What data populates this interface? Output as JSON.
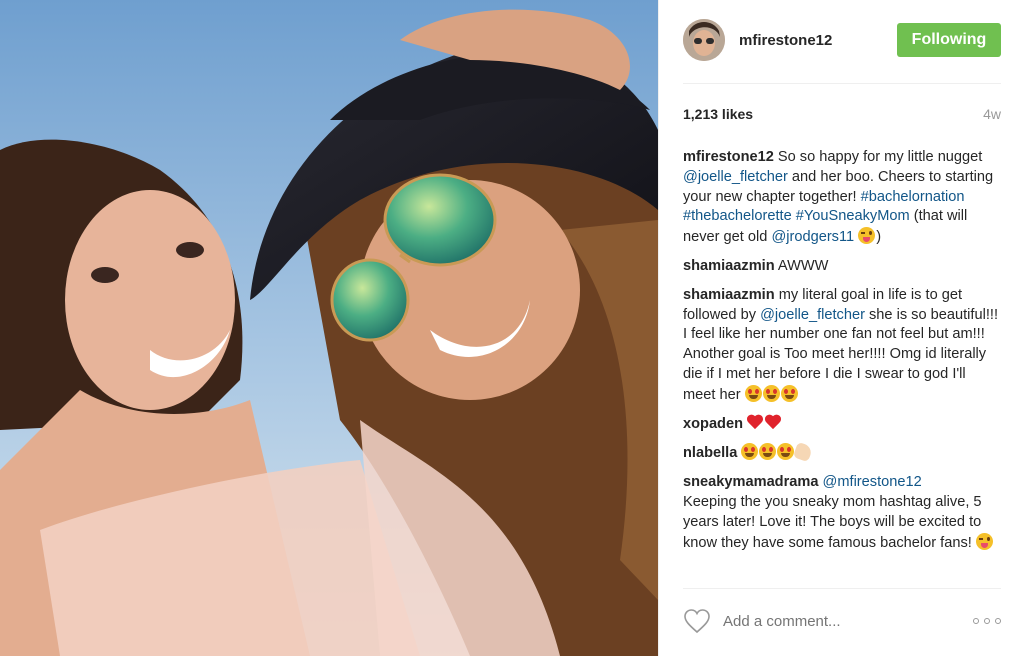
{
  "post": {
    "username": "mfirestone12",
    "follow_label": "Following",
    "likes": "1,213 likes",
    "age": "4w"
  },
  "caption": {
    "user": "mfirestone12",
    "t1": " So so happy for my little nugget ",
    "mention1": "@joelle_fletcher",
    "t2": " and her boo. Cheers to starting your new chapter together! ",
    "tag1": "#bachelornation",
    "tag2": "#thebachelorette",
    "tag3": "#YouSneakyMom",
    "t3": " (that will never get old ",
    "mention2": "@jrodgers11",
    "t4": ")"
  },
  "comments": [
    {
      "user": "shamiaazmin",
      "text": " AWWW"
    },
    {
      "user": "shamiaazmin",
      "t1": " my literal goal in life is to get followed by ",
      "mention": "@joelle_fletcher",
      "t2": " she is so beautiful!!! I feel like her number one fan not feel but am!!! Another goal is Too meet her!!!! Omg id literally die if I met her before I die I swear to god I'll meet her "
    },
    {
      "user": "xopaden",
      "text": " "
    },
    {
      "user": "nlabella",
      "text": " "
    },
    {
      "user": "sneakymamadrama",
      "mention": " @mfirestone12",
      "text": "Keeping the you sneaky mom hashtag alive, 5 years later! Love it! The boys will be excited to know they have some famous bachelor fans! "
    }
  ],
  "comment_box": {
    "placeholder": "Add a comment..."
  },
  "icons": {
    "like": "heart-outline-icon",
    "more": "more-options-icon",
    "link_color": "#125688",
    "follow_color": "#70c050"
  }
}
